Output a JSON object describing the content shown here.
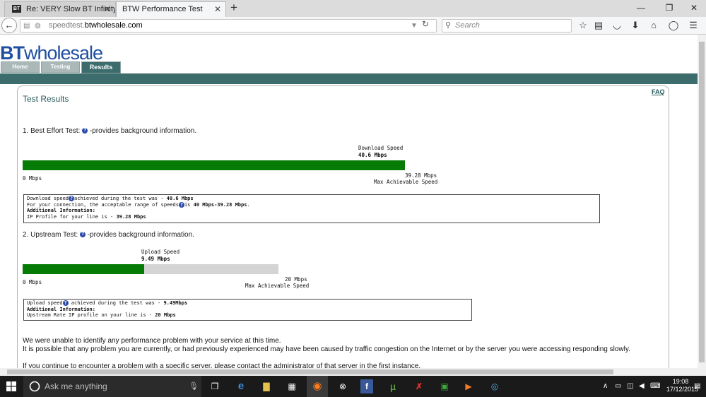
{
  "browser": {
    "tabs": [
      {
        "favicon": "BT",
        "title": "Re: VERY Slow BT Infinity ...",
        "active": false
      },
      {
        "title": "BTW Performance Test",
        "active": true
      }
    ],
    "url_prefix": "speedtest.",
    "url_domain": "btwholesale.com",
    "search_placeholder": "Search",
    "toolbar_icons": [
      "star-icon",
      "reading-list-icon",
      "pocket-icon",
      "download-icon",
      "home-icon",
      "chat-icon",
      "menu-icon"
    ]
  },
  "site": {
    "logo_bt": "BT",
    "logo_rest": "wholesale",
    "nav_tabs": [
      "Home",
      "Testing",
      "Results"
    ],
    "active_tab": "Results"
  },
  "results": {
    "title": "Test Results",
    "faq": "FAQ",
    "download": {
      "heading": "1. Best Effort Test:",
      "heading_suffix": "-provides background information.",
      "speed_label": "Download Speed",
      "speed_value": "40.6 Mbps",
      "fill_fraction": 1.0,
      "min_label": "0 Mbps",
      "max_value": "39.28 Mbps",
      "max_label": "Max Achievable Speed",
      "info": {
        "line1_a": "Download speed",
        "line1_b": "achieved during the test was - ",
        "line1_value": "40.6 Mbps",
        "line2_a": "For your connection, the acceptable range of speeds",
        "line2_b": "is ",
        "line2_value": "40 Mbps-39.28 Mbps",
        "line2_end": ".",
        "line3": "Additional Information:",
        "line4_a": "IP Profile for your line is - ",
        "line4_value": "39.28 Mbps"
      }
    },
    "upload": {
      "heading": "2. Upstream Test:",
      "heading_suffix": "-provides background information.",
      "speed_label": "Upload Speed",
      "speed_value": "9.49 Mbps",
      "fill_fraction": 0.4745,
      "min_label": "0 Mbps",
      "max_value": "20 Mbps",
      "max_label": "Max Achievable Speed",
      "info": {
        "line1_a": "Upload speed",
        "line1_b": " achieved during the test was - ",
        "line1_value": "9.49Mbps",
        "line2": "Additional Information:",
        "line3_a": "Upstream Rate IP profile on your line is - ",
        "line3_value": "20 Mbps"
      }
    },
    "message": {
      "p1": "We were unable to identify any performance problem with your service at this time.",
      "p2": "It is possible that any problem you are currently, or had previously experienced may have been caused by traffic congestion on the Internet or by the server you were accessing responding slowly.",
      "p3": "If you continue to encounter a problem with a specific server, please contact the administrator of that server in the first instance."
    }
  },
  "taskbar": {
    "search_placeholder": "Ask me anything",
    "apps": [
      "task-view-icon",
      "edge-icon",
      "file-explorer-icon",
      "store-icon",
      "firefox-icon",
      "xbox-icon",
      "facebook-icon",
      "utorrent-icon",
      "app-x-icon",
      "app-green-icon",
      "media-player-icon",
      "app-blue-icon"
    ],
    "time": "19:08",
    "date": "17/12/2015"
  },
  "colors": {
    "bar_green": "#067c06",
    "teal": "#3c6c6c",
    "bt_blue": "#1f4fa0"
  }
}
